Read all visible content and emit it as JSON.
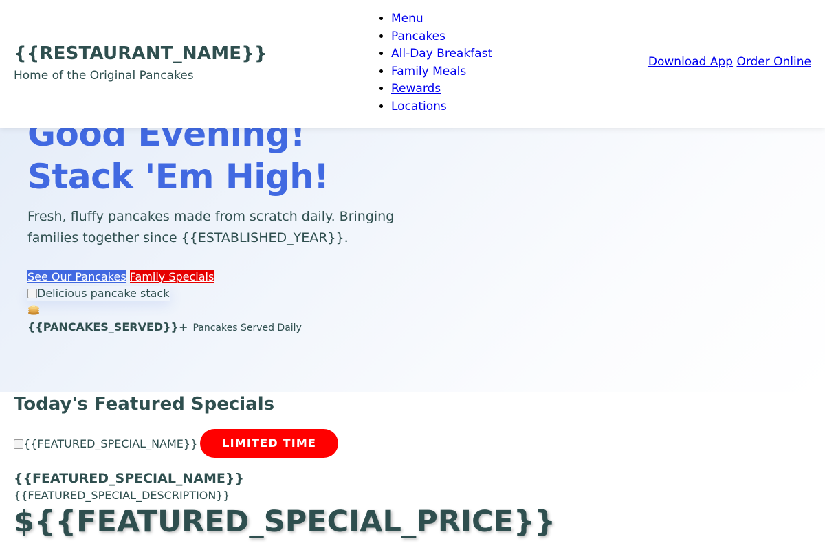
{
  "header": {
    "restaurant_name": "{{RESTAURANT_NAME}}",
    "tagline": "Home of the Original Pancakes",
    "nav": [
      "Menu",
      "Pancakes",
      "All-Day Breakfast",
      "Family Meals",
      "Rewards",
      "Locations"
    ],
    "actions": {
      "download_app": "Download App",
      "order_online": "Order Online"
    }
  },
  "hero": {
    "title_line1": "Good Evening!",
    "title_line2": "Stack 'Em High!",
    "subtitle": "Fresh, fluffy pancakes made from scratch daily. Bringing families together since {{ESTABLISHED_YEAR}}.",
    "primary_button": "See Our Pancakes",
    "secondary_button": "Family Specials",
    "image_alt": "Delicious pancake stack",
    "stat_value": "{{PANCAKES_SERVED}}+",
    "stat_label": "Pancakes Served Daily"
  },
  "specials": {
    "title": "Today's Featured Specials",
    "image_alt": "{{FEATURED_SPECIAL_NAME}}",
    "badge": "LIMITED TIME",
    "name": "{{FEATURED_SPECIAL_NAME}}",
    "description": "{{FEATURED_SPECIAL_DESCRIPTION}}",
    "price": "${{FEATURED_SPECIAL_PRICE}}"
  },
  "colors": {
    "brand_text": "#2f4f4f",
    "hero_title": "#4169e1",
    "primary_button_bg": "#4169e1",
    "secondary_button_bg": "#e60000",
    "badge_bg": "#ff0000",
    "link": "#0000ee"
  },
  "icons": {
    "hero_image": "broken-image-icon",
    "hero_emoji": "pancakes-icon",
    "special_image": "broken-image-icon"
  }
}
